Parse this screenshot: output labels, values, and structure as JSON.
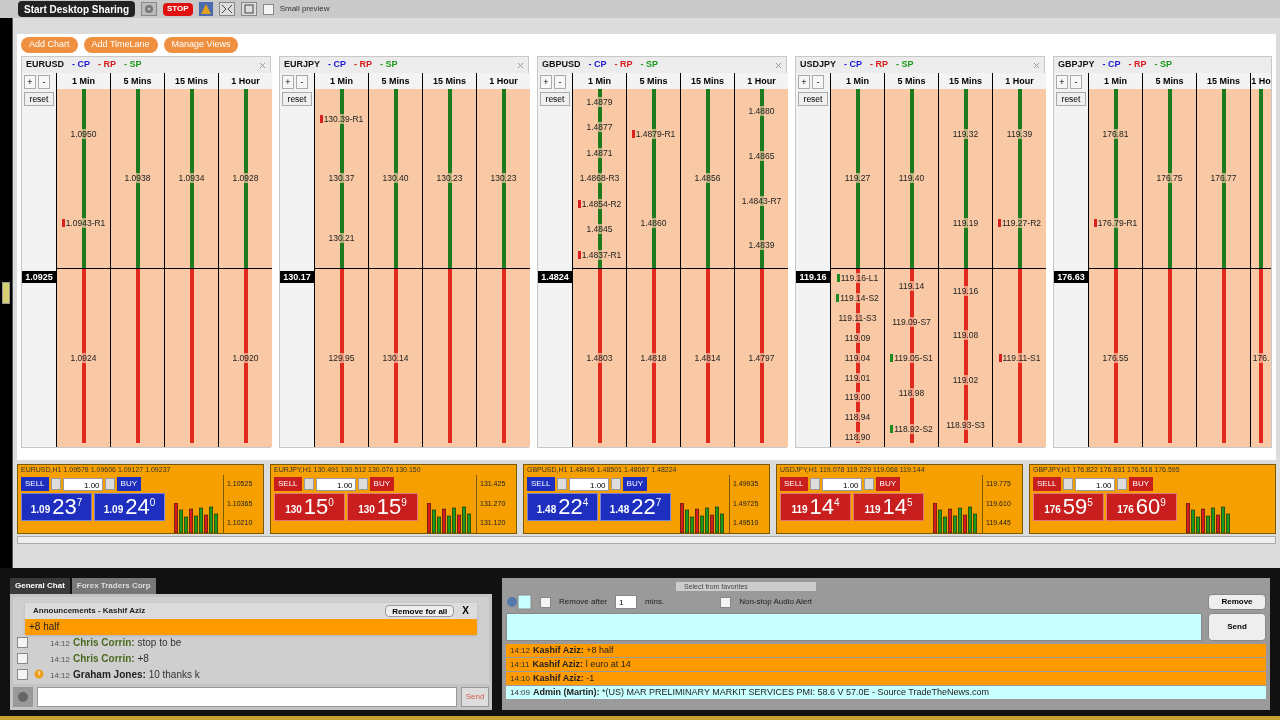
{
  "top_bar": {
    "share_button": "Start Desktop Sharing",
    "stop_button": "STOP",
    "small_preview": {
      "label": "Small preview",
      "checked": false
    }
  },
  "toolbar": [
    "Add Chart",
    "Add TimeLane",
    "Manage Views"
  ],
  "panels": [
    {
      "pair": "EURUSD",
      "legend": [
        {
          "text": "- CP",
          "color": "#1c1cd8"
        },
        {
          "text": "- RP",
          "color": "#d81c1c"
        },
        {
          "text": "- SP",
          "color": "#1c9a1c"
        }
      ],
      "zoom_in": "+",
      "zoom_out": "-",
      "reset": "reset",
      "current": "1.0925",
      "columns": [
        {
          "label": "1 Min",
          "above": [
            {
              "text": "1.0950"
            },
            {
              "text": "1.0943-R1",
              "color": "#d82020"
            }
          ],
          "below": [
            {
              "text": "1.0924"
            }
          ]
        },
        {
          "label": "5 Mins",
          "above": [
            {
              "text": "1.0938"
            }
          ]
        },
        {
          "label": "15 Mins",
          "above": [
            {
              "text": "1.0934"
            }
          ]
        },
        {
          "label": "1 Hour",
          "above": [
            {
              "text": "1.0928"
            }
          ],
          "below": [
            {
              "text": "1.0920"
            }
          ]
        }
      ]
    },
    {
      "pair": "EURJPY",
      "legend": [
        {
          "text": "- CP",
          "color": "#1c1cd8"
        },
        {
          "text": "- RP",
          "color": "#d81c1c"
        },
        {
          "text": "- SP",
          "color": "#1c9a1c"
        }
      ],
      "zoom_in": "+",
      "zoom_out": "-",
      "reset": "reset",
      "current": "130.17",
      "columns": [
        {
          "label": "1 Min",
          "above": [
            {
              "text": "130.39-R1",
              "color": "#d82020"
            },
            {
              "text": "130.37"
            },
            {
              "text": "130.21"
            }
          ],
          "below": [
            {
              "text": "129.95"
            }
          ]
        },
        {
          "label": "5 Mins",
          "above": [
            {
              "text": "130.40"
            }
          ],
          "below": [
            {
              "text": "130.14"
            }
          ]
        },
        {
          "label": "15 Mins",
          "above": [
            {
              "text": "130.23"
            }
          ]
        },
        {
          "label": "1 Hour",
          "above": [
            {
              "text": "130.23"
            }
          ]
        }
      ]
    },
    {
      "pair": "GBPUSD",
      "legend": [
        {
          "text": "- CP",
          "color": "#1c1cd8"
        },
        {
          "text": "- RP",
          "color": "#d81c1c"
        },
        {
          "text": "- SP",
          "color": "#1c9a1c"
        }
      ],
      "zoom_in": "+",
      "zoom_out": "-",
      "reset": "reset",
      "current": "1.4824",
      "columns": [
        {
          "label": "1 Min",
          "above": [
            {
              "text": "1.4879"
            },
            {
              "text": "1.4877"
            },
            {
              "text": "1.4871"
            },
            {
              "text": "1.4868-R3"
            },
            {
              "text": "1.4854-R2",
              "color": "#d82020"
            },
            {
              "text": "1.4845"
            },
            {
              "text": "1.4837-R1",
              "color": "#d82020"
            }
          ],
          "below": [
            {
              "text": "1.4803"
            }
          ]
        },
        {
          "label": "5 Mins",
          "above": [
            {
              "text": "1.4879-R1",
              "color": "#d82020"
            },
            {
              "text": "1.4860"
            }
          ],
          "below": [
            {
              "text": "1.4818"
            }
          ]
        },
        {
          "label": "15 Mins",
          "above": [
            {
              "text": "1.4856"
            }
          ],
          "below": [
            {
              "text": "1.4814"
            }
          ]
        },
        {
          "label": "1 Hour",
          "above": [
            {
              "text": "1.4880"
            },
            {
              "text": "1.4865"
            },
            {
              "text": "1.4843-R7"
            },
            {
              "text": "1.4839"
            }
          ],
          "below": [
            {
              "text": "1.4797"
            }
          ]
        }
      ]
    },
    {
      "pair": "USDJPY",
      "legend": [
        {
          "text": "- CP",
          "color": "#1c1cd8"
        },
        {
          "text": "- RP",
          "color": "#d81c1c"
        },
        {
          "text": "- SP",
          "color": "#1c9a1c"
        }
      ],
      "zoom_in": "+",
      "zoom_out": "-",
      "reset": "reset",
      "current": "119.16",
      "columns": [
        {
          "label": "1 Min",
          "above": [
            {
              "text": "119.27"
            }
          ],
          "below": [
            {
              "text": "119.16-L1",
              "color": "#1c8a1c"
            },
            {
              "text": "119.14-S2",
              "color": "#1c8a1c"
            },
            {
              "text": "119.11-S3"
            },
            {
              "text": "119.09"
            },
            {
              "text": "119.04"
            },
            {
              "text": "119.01"
            },
            {
              "text": "119.00"
            },
            {
              "text": "118.94"
            },
            {
              "text": "118.90"
            }
          ]
        },
        {
          "label": "5 Mins",
          "above": [
            {
              "text": "119.40"
            }
          ],
          "below": [
            {
              "text": "119.14"
            },
            {
              "text": "119.09-S7"
            },
            {
              "text": "119.05-S1",
              "color": "#1c8a1c"
            },
            {
              "text": "118.98"
            },
            {
              "text": "118.92-S2",
              "color": "#1c8a1c"
            }
          ]
        },
        {
          "label": "15 Mins",
          "above": [
            {
              "text": "119.32"
            },
            {
              "text": "119.19"
            }
          ],
          "below": [
            {
              "text": "119.16"
            },
            {
              "text": "119.08"
            },
            {
              "text": "119.02"
            },
            {
              "text": "118.93-S3"
            }
          ]
        },
        {
          "label": "1 Hour",
          "above": [
            {
              "text": "119.39"
            },
            {
              "text": "119.27-R2",
              "color": "#d82020"
            }
          ],
          "below": [
            {
              "text": "119.11-S1",
              "color": "#d82020"
            }
          ]
        }
      ]
    },
    {
      "pair": "GBPJPY",
      "legend": [
        {
          "text": "- CP",
          "color": "#1c1cd8"
        },
        {
          "text": "- RP",
          "color": "#d81c1c"
        },
        {
          "text": "- SP",
          "color": "#1c9a1c"
        }
      ],
      "zoom_in": "+",
      "zoom_out": "-",
      "reset": "reset",
      "current": "176.63",
      "columns": [
        {
          "label": "1 Min",
          "above": [
            {
              "text": "176.81"
            },
            {
              "text": "176.79-R1",
              "color": "#d82020"
            }
          ],
          "below": [
            {
              "text": "176.55"
            }
          ]
        },
        {
          "label": "5 Mins",
          "above": [
            {
              "text": "176.75"
            }
          ]
        },
        {
          "label": "15 Mins",
          "above": [
            {
              "text": "176.77"
            }
          ]
        },
        {
          "label": "1 Ho",
          "below": [
            {
              "text": "176."
            }
          ]
        }
      ]
    }
  ],
  "tiles": [
    {
      "header": "EURUSD,H1 1.09578 1.09606 1.09127 1.09237",
      "color": "#1e2fc0",
      "sell": "SELL",
      "buy": "BUY",
      "amount": "1.00",
      "bid": [
        "1.09",
        "23",
        "7"
      ],
      "ask": [
        "1.09",
        "24",
        "0"
      ],
      "axis": [
        "1.10525",
        "1.10365",
        "1.10210"
      ]
    },
    {
      "header": "EURJPY,H1 130.491 130.512 130.076 130.150",
      "color": "#c81e1e",
      "sell": "SELL",
      "buy": "BUY",
      "amount": "1.00",
      "bid": [
        "130",
        "15",
        "0"
      ],
      "ask": [
        "130",
        "15",
        "9"
      ],
      "axis": [
        "131.425",
        "131.270",
        "131.120"
      ]
    },
    {
      "header": "GBPUSD,H1 1.48496 1.48501 1.48067 1.48224",
      "color": "#1e2fc0",
      "sell": "SELL",
      "buy": "BUY",
      "amount": "1.00",
      "bid": [
        "1.48",
        "22",
        "4"
      ],
      "ask": [
        "1.48",
        "22",
        "7"
      ],
      "axis": [
        "1.49935",
        "1.49725",
        "1.49510"
      ]
    },
    {
      "header": "USDJPY,H1 119.078 119.229 119.068 119.144",
      "color": "#c81e1e",
      "sell": "SELL",
      "buy": "BUY",
      "amount": "1.00",
      "bid": [
        "119",
        "14",
        "4"
      ],
      "ask": [
        "119",
        "14",
        "5"
      ],
      "axis": [
        "119.775",
        "119.610",
        "119.445"
      ]
    },
    {
      "header": "GBPJPY,H1 176.822 176.831 176.518 176.595",
      "color": "#c81e1e",
      "sell": "SELL",
      "buy": "BUY",
      "amount": "1.00",
      "bid": [
        "176",
        "59",
        "5"
      ],
      "ask": [
        "176",
        "60",
        "9"
      ]
    }
  ],
  "chat": {
    "tabs": [
      {
        "label": "General Chat",
        "selected": true
      },
      {
        "label": "Forex Traders Corp",
        "selected": false
      }
    ],
    "announcement": {
      "title": "Announcements - Kashif Aziz",
      "remove_button": "Remove for all",
      "close": "X",
      "message": "+8 half"
    },
    "messages": [
      {
        "time": "14:12",
        "author": "Chris Corrin:",
        "text": "stop to be",
        "checked": false,
        "flagged": false
      },
      {
        "time": "14:12",
        "author": "Chris Corrin:",
        "text": "+8",
        "checked": false,
        "flagged": false
      },
      {
        "time": "14:12",
        "author": "Graham Jones:",
        "text": "10 thanks k",
        "checked": false,
        "flagged": true
      }
    ],
    "send": "Send"
  },
  "broadcast": {
    "favorites": "Select from favorites",
    "remove_after": {
      "label": "Remove after",
      "checked": false
    },
    "minutes": "1",
    "minutes_unit": "mins.",
    "nonstop": {
      "label": "Non-stop Audio Alert",
      "checked": false
    },
    "remove_button": "Remove",
    "send_button": "Send",
    "feed": [
      {
        "time": "14:12",
        "author": "Kashif Aziz:",
        "text": "+8 half",
        "highlighted": true
      },
      {
        "time": "14:11",
        "author": "Kashif Aziz:",
        "text": "l euro at 14",
        "highlighted": true
      },
      {
        "time": "14:10",
        "author": "Kashif Aziz:",
        "text": "-1",
        "highlighted": true
      },
      {
        "time": "14:09",
        "author": "Admin (Martin):",
        "text": "*(US) MAR PRELIMINARY MARKIT SERVICES PMI: 58.6 V 57.0E - Source TradeTheNews.com",
        "highlighted": false
      }
    ]
  }
}
